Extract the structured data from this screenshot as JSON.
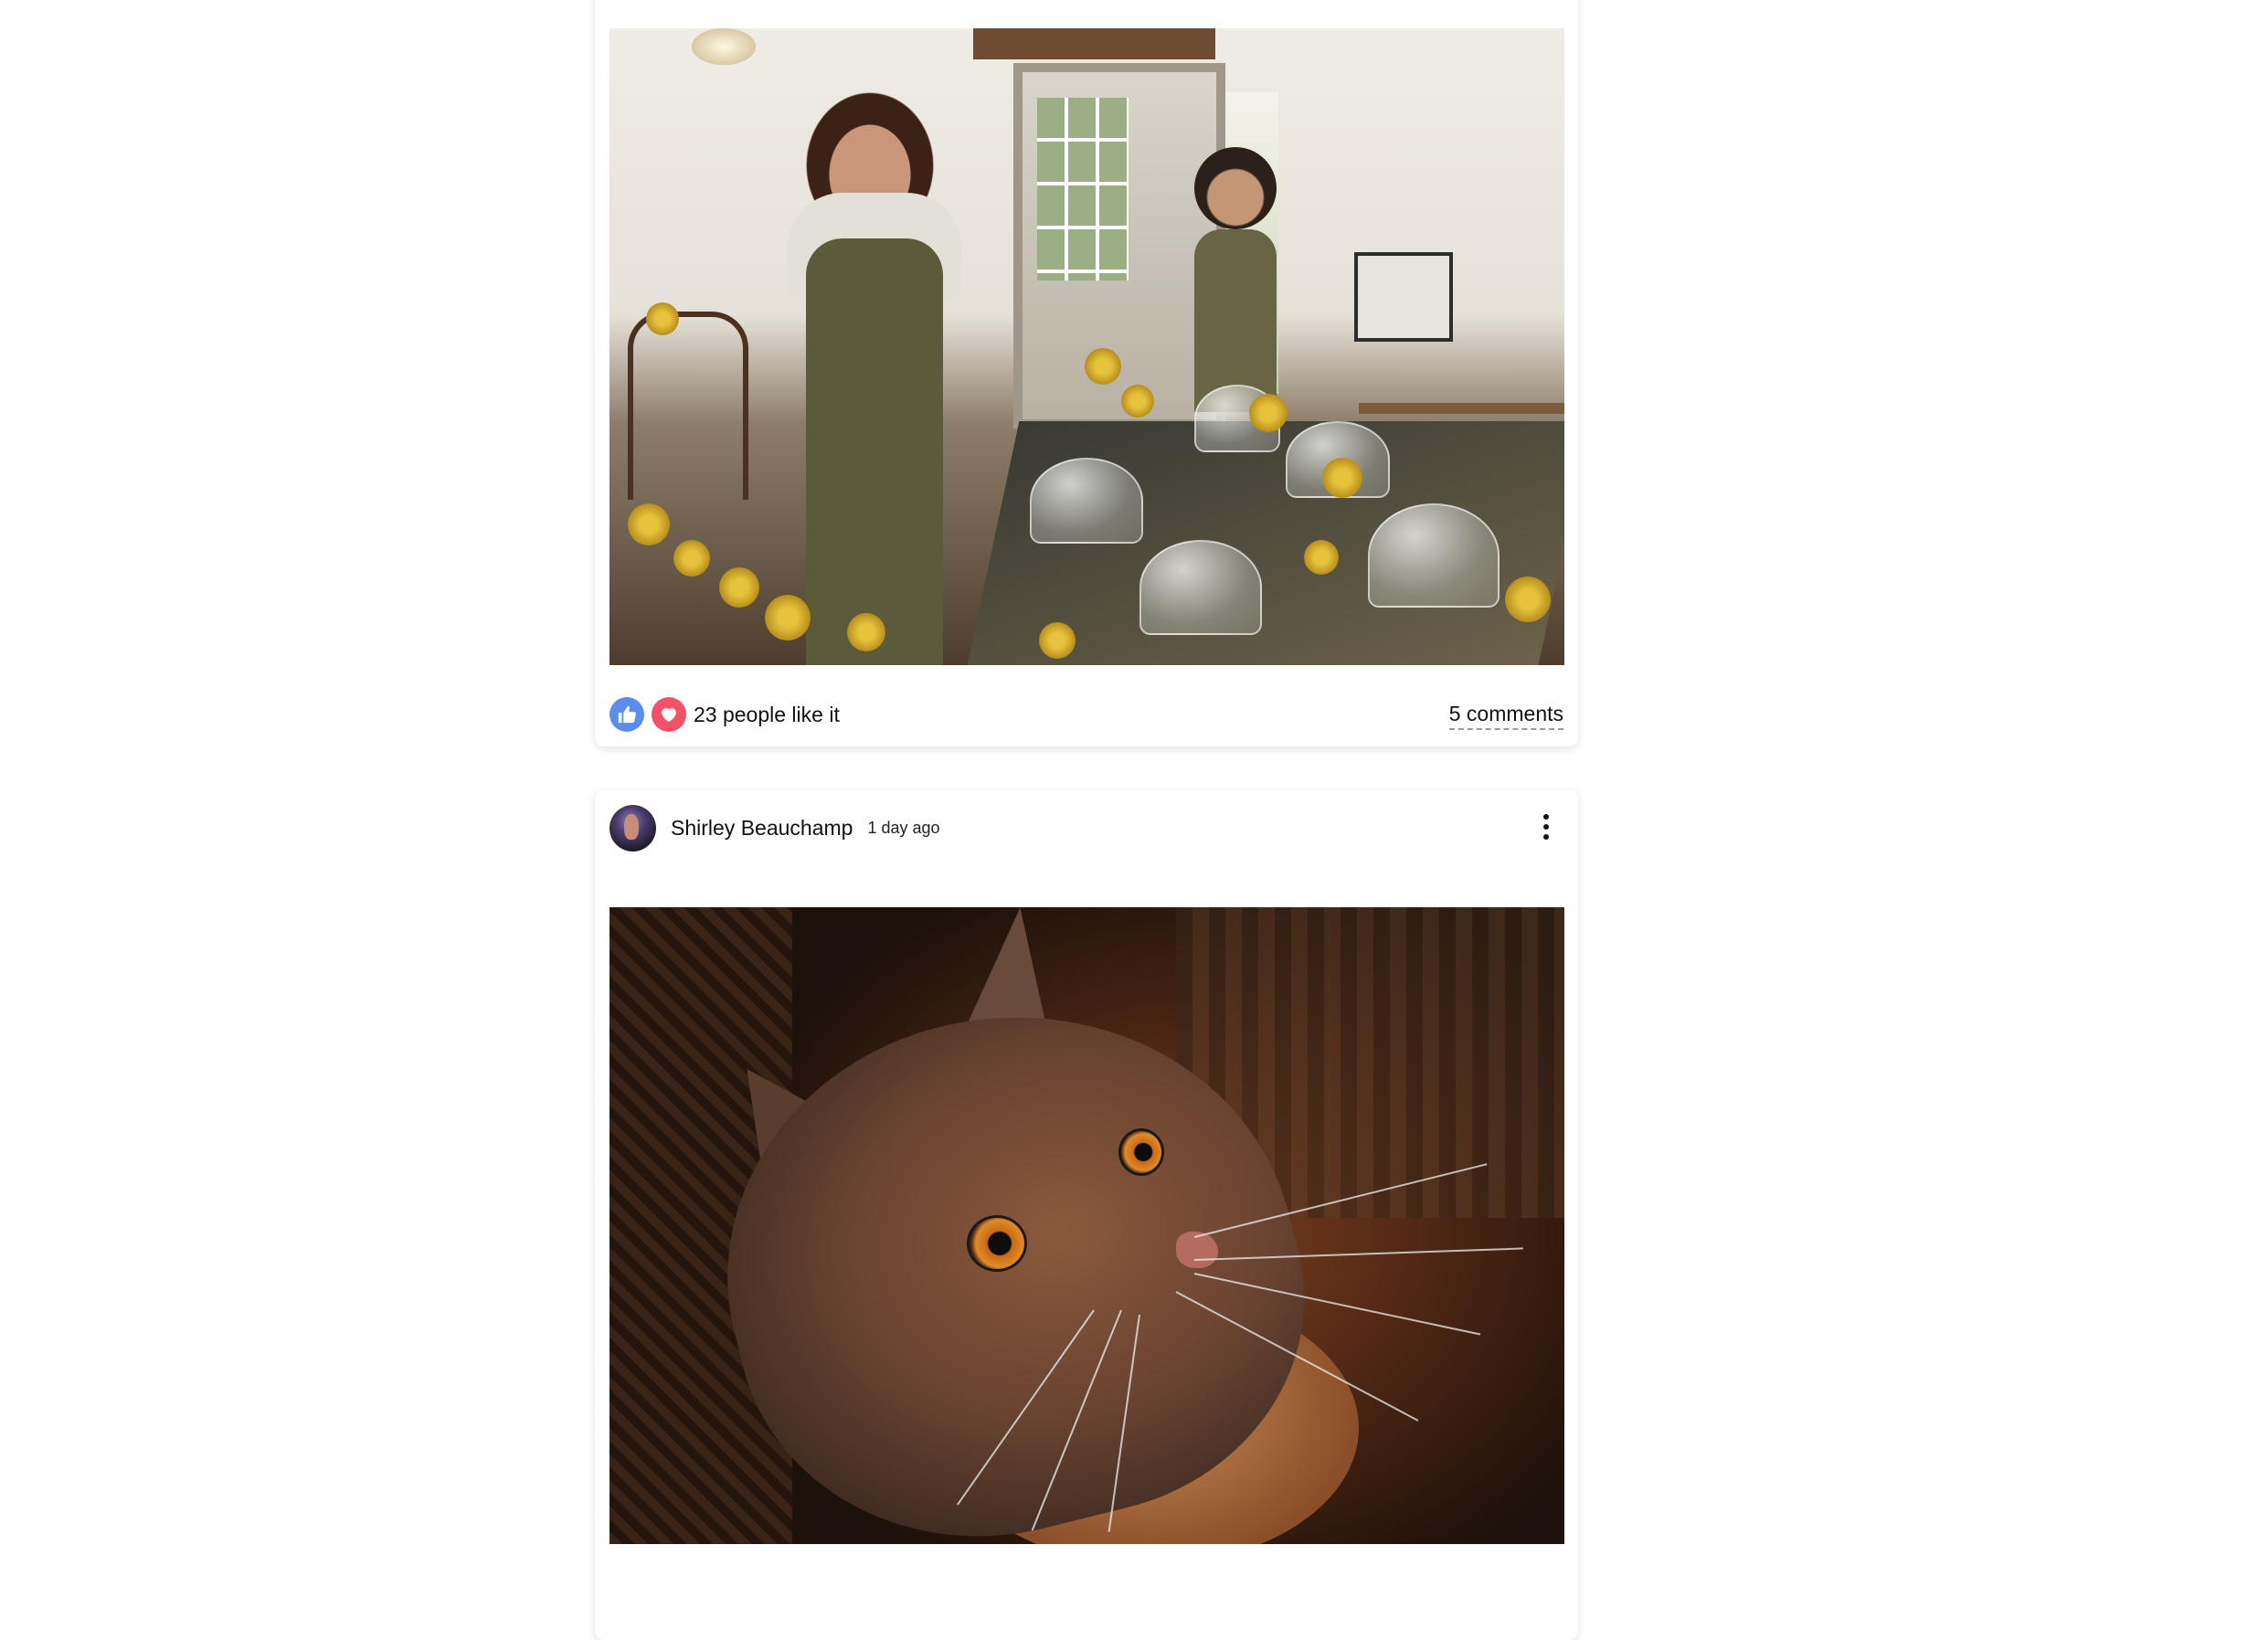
{
  "feed": {
    "posts": [
      {
        "image_alt": "Two women in aprons in a rustic cafe with glass cake domes and yellow flowers",
        "reactions": {
          "icons": [
            "thumbs-up-icon",
            "heart-icon"
          ],
          "like_text": "23 people like it"
        },
        "comments_label": "5 comments"
      },
      {
        "author": "Shirley Beauchamp",
        "time": "1 day ago",
        "menu_icon": "more-vertical-icon",
        "image_alt": "Close-up of a ginger cat looking up"
      }
    ]
  },
  "colors": {
    "like": "#5b8def",
    "love": "#f25267",
    "text": "#111111",
    "card_background": "#ffffff"
  }
}
